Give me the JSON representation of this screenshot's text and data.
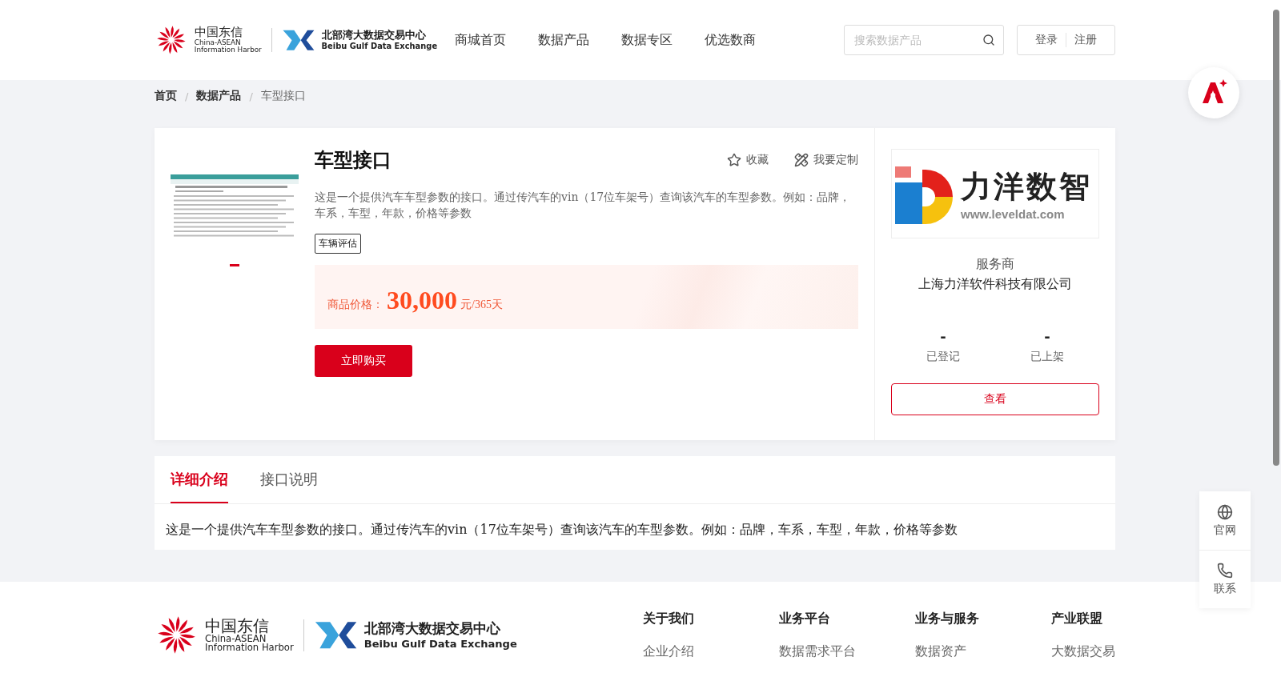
{
  "header": {
    "logo": {
      "cn": "中国东信",
      "en1": "China-ASEAN",
      "en2": "Information Harbor",
      "name_cn": "北部湾大数据交易中心",
      "name_en": "Beibu Gulf Data Exchange"
    },
    "nav": [
      {
        "label": "商城首页",
        "selected": false
      },
      {
        "label": "数据产品",
        "selected": false
      },
      {
        "label": "数据专区",
        "selected": false
      },
      {
        "label": "优选数商",
        "selected": false
      }
    ],
    "search": {
      "placeholder": "搜索数据产品"
    },
    "auth": [
      "登录",
      "注册"
    ]
  },
  "breadcrumb": {
    "separator": "/",
    "items": [
      "首页",
      "数据产品",
      "车型接口"
    ]
  },
  "product": {
    "title": "车型接口",
    "actions": [
      {
        "kind": "star",
        "label": "收藏"
      },
      {
        "kind": "custom",
        "label": "我要定制"
      }
    ],
    "description": "这是一个提供汽车车型参数的接口。通过传汽车的vin（17位车架号）查询该汽车的车型参数。例如：品牌，车系，车型，年款，价格等参数",
    "tags": [
      "车辆评估"
    ],
    "price": {
      "label": "商品价格：",
      "amount": "30,000",
      "unit": "元/365天"
    },
    "buy_button": "立即购买",
    "gallery": [
      {
        "kind": "picture",
        "selected": true
      }
    ]
  },
  "provider": {
    "logo": {
      "name": "力洋数智",
      "url": "www.leveldat.com"
    },
    "role": "服务商",
    "name": "上海力洋软件科技有限公司",
    "stats": [
      {
        "value": "-",
        "label": "已登记"
      },
      {
        "value": "-",
        "label": "已上架"
      }
    ],
    "button": "查看"
  },
  "detail": {
    "tabs": [
      {
        "label": "详细介绍",
        "selected": true
      },
      {
        "label": "接口说明",
        "selected": false
      }
    ],
    "text": "这是一个提供汽车车型参数的接口。通过传汽车的vin（17位车架号）查询该汽车的车型参数。例如：品牌，车系，车型，年款，价格等参数"
  },
  "side_widget": [
    {
      "kind": "globe",
      "label": "官网"
    },
    {
      "kind": "phone",
      "label": "联系"
    }
  ],
  "footer": {
    "logo": {
      "cn": "中国东信",
      "en1": "China-ASEAN",
      "en2": "Information Harbor",
      "name_cn": "北部湾大数据交易中心",
      "name_en": "Beibu Gulf Data Exchange"
    },
    "columns": [
      {
        "title": "关于我们",
        "links": [
          "企业介绍"
        ]
      },
      {
        "title": "业务平台",
        "links": [
          "数据需求平台"
        ]
      },
      {
        "title": "业务与服务",
        "links": [
          "数据资产"
        ]
      },
      {
        "title": "产业联盟",
        "links": [
          "大数据交易"
        ]
      }
    ]
  }
}
